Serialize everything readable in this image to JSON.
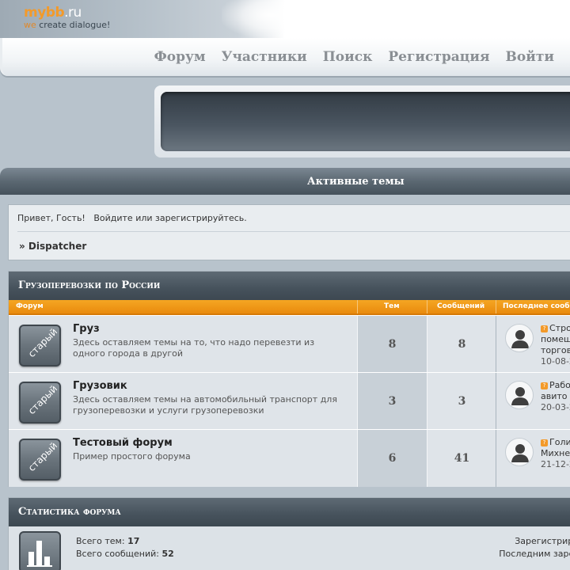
{
  "logo": {
    "brand": "mybb",
    "tld": ".ru",
    "tagline_we": "we",
    "tagline_rest": " create dialogue!"
  },
  "nav": {
    "items": [
      "Форум",
      "Участники",
      "Поиск",
      "Регистрация",
      "Войти"
    ]
  },
  "active_topics": {
    "label": "Активные темы"
  },
  "welcome": {
    "greeting": "Привет, Гость!",
    "login_link": "Войдите",
    "or": "или",
    "register_link": "зарегистрируйтесь."
  },
  "breadcrumb": "» Dispatcher",
  "category": {
    "title": "Грузоперевозки по России",
    "columns": {
      "forum": "Форум",
      "topics": "Тем",
      "posts": "Сообщений",
      "last_post": "Последнее сооб"
    },
    "forums": [
      {
        "badge": "старый",
        "name": "Груз",
        "description": "Здесь оставляем темы на то, что надо перевезти из одного города в другой",
        "topics": "8",
        "posts": "8",
        "last_post_lines": [
          "Стро",
          "помещ",
          "торгов"
        ],
        "last_post_date": "10-08-2"
      },
      {
        "badge": "старый",
        "name": "Грузовик",
        "description": "Здесь оставляем темы на автомобильный транспорт для грузоперевозки и услуги грузоперевозки",
        "topics": "3",
        "posts": "3",
        "last_post_lines": [
          "Рабо",
          "авито"
        ],
        "last_post_date": "20-03-2"
      },
      {
        "badge": "старый",
        "name": "Тестовый форум",
        "description": "Пример простого форума",
        "topics": "6",
        "posts": "41",
        "last_post_lines": [
          "Голи",
          "Михне"
        ],
        "last_post_date": "21-12-2"
      }
    ]
  },
  "stats": {
    "title": "Статистика форума",
    "total_topics_label": "Всего тем:",
    "total_topics": "17",
    "total_posts_label": "Всего сообщений:",
    "total_posts": "52",
    "registered_label": "Зарегистриро",
    "last_registered_label": "Последним зарег"
  },
  "colors": {
    "accent": "#f39a2a",
    "header_dark": "#46525c"
  },
  "icons": [
    "user-avatar-icon",
    "stats-chart-icon",
    "new-post-icon"
  ]
}
